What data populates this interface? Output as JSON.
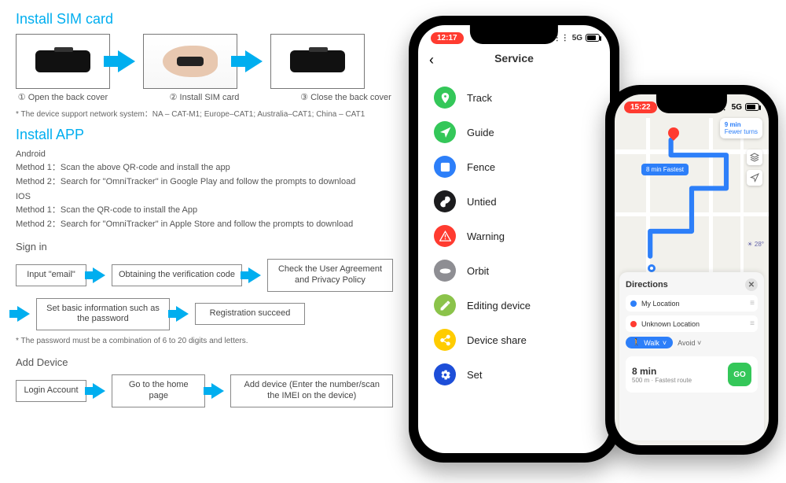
{
  "sim": {
    "heading": "Install SIM card",
    "steps": {
      "s1": "① Open the back cover",
      "s2": "② Install SIM card",
      "s3": "③ Close the back cover"
    },
    "footnote": "* The device support network system：NA – CAT-M1; Europe–CAT1; Australia–CAT1;   China – CAT1"
  },
  "app": {
    "heading": "Install APP",
    "android_label": "Android",
    "android_m1": "Method 1：Scan the above QR-code and install the app",
    "android_m2": "Method 2：Search for \"OmniTracker\" in Google Play and follow the prompts to download",
    "ios_label": "IOS",
    "ios_m1": "Method 1：Scan the QR-code to install the App",
    "ios_m2": "Method 2：Search for \"OmniTracker\" in Apple Store and follow the prompts to download"
  },
  "signin": {
    "heading": "Sign in",
    "b1": "Input \"email\"",
    "b2": "Obtaining the verification code",
    "b3": "Check the User Agreement and Privacy Policy",
    "b4": "Set basic information such as the password",
    "b5": "Registration succeed",
    "footnote": "* The password must be a combination of 6 to 20 digits and letters."
  },
  "add": {
    "heading": "Add Device",
    "b1": "Login Account",
    "b2": "Go to the home page",
    "b3": "Add device (Enter the number/scan the IMEI on the device)"
  },
  "phone_service": {
    "time": "12:17",
    "network": "5G",
    "battery": "78",
    "title": "Service",
    "items": [
      {
        "label": "Track",
        "color": "#34c759",
        "icon": "loc"
      },
      {
        "label": "Guide",
        "color": "#34c759",
        "icon": "nav"
      },
      {
        "label": "Fence",
        "color": "#2d7ff9",
        "icon": "fence"
      },
      {
        "label": "Untied",
        "color": "#1c1c1e",
        "icon": "link"
      },
      {
        "label": "Warning",
        "color": "#ff3b30",
        "icon": "warn"
      },
      {
        "label": "Orbit",
        "color": "#8e8e93",
        "icon": "orbit"
      },
      {
        "label": "Editing device",
        "color": "#8bc34a",
        "icon": "edit"
      },
      {
        "label": "Device share",
        "color": "#ffcc00",
        "icon": "share"
      },
      {
        "label": "Set",
        "color": "#1d4ed8",
        "icon": "gear"
      }
    ]
  },
  "phone_map": {
    "time": "15:22",
    "network": "5G",
    "top_eta": "9 min",
    "top_sub": "Fewer turns",
    "route_label": "8 min Fastest",
    "weather": "28°",
    "directions_title": "Directions",
    "from": "My Location",
    "to": "Unknown Location",
    "walk": "Walk",
    "avoid": "Avoid",
    "eta_main": "8 min",
    "eta_sub": "500 m · Fastest route",
    "go": "GO"
  }
}
